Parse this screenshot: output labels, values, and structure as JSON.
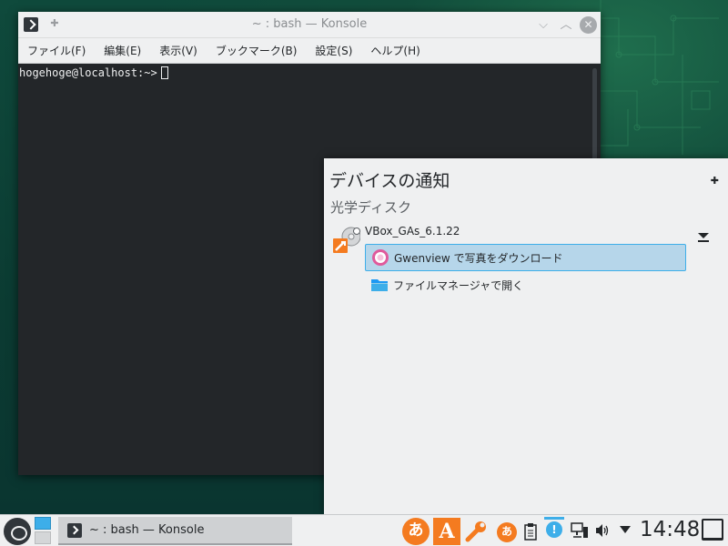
{
  "konsole": {
    "window_title": "~ : bash — Konsole",
    "menu": [
      "ファイル(F)",
      "編集(E)",
      "表示(V)",
      "ブックマーク(B)",
      "設定(S)",
      "ヘルプ(H)"
    ],
    "prompt": "hogehoge@localhost:~>"
  },
  "notifier": {
    "title": "デバイスの通知",
    "section": "光学ディスク",
    "device_name": "VBox_GAs_6.1.22",
    "actions": [
      {
        "label": "Gwenview で写真をダウンロード",
        "icon": "gwenview-icon"
      },
      {
        "label": "ファイルマネージャで開く",
        "icon": "folder-icon"
      }
    ]
  },
  "taskbar": {
    "task_label": "~ : bash — Konsole",
    "ime_label_1": "あ",
    "ime_label_2": "A",
    "ime_label_3": "あ",
    "updater_label": "!",
    "clock": "14:48"
  },
  "colors": {
    "accent": "#3daee9",
    "highlight": "#b6d6ea",
    "ime_orange": "#f47b20",
    "terminal_bg": "#232629"
  }
}
